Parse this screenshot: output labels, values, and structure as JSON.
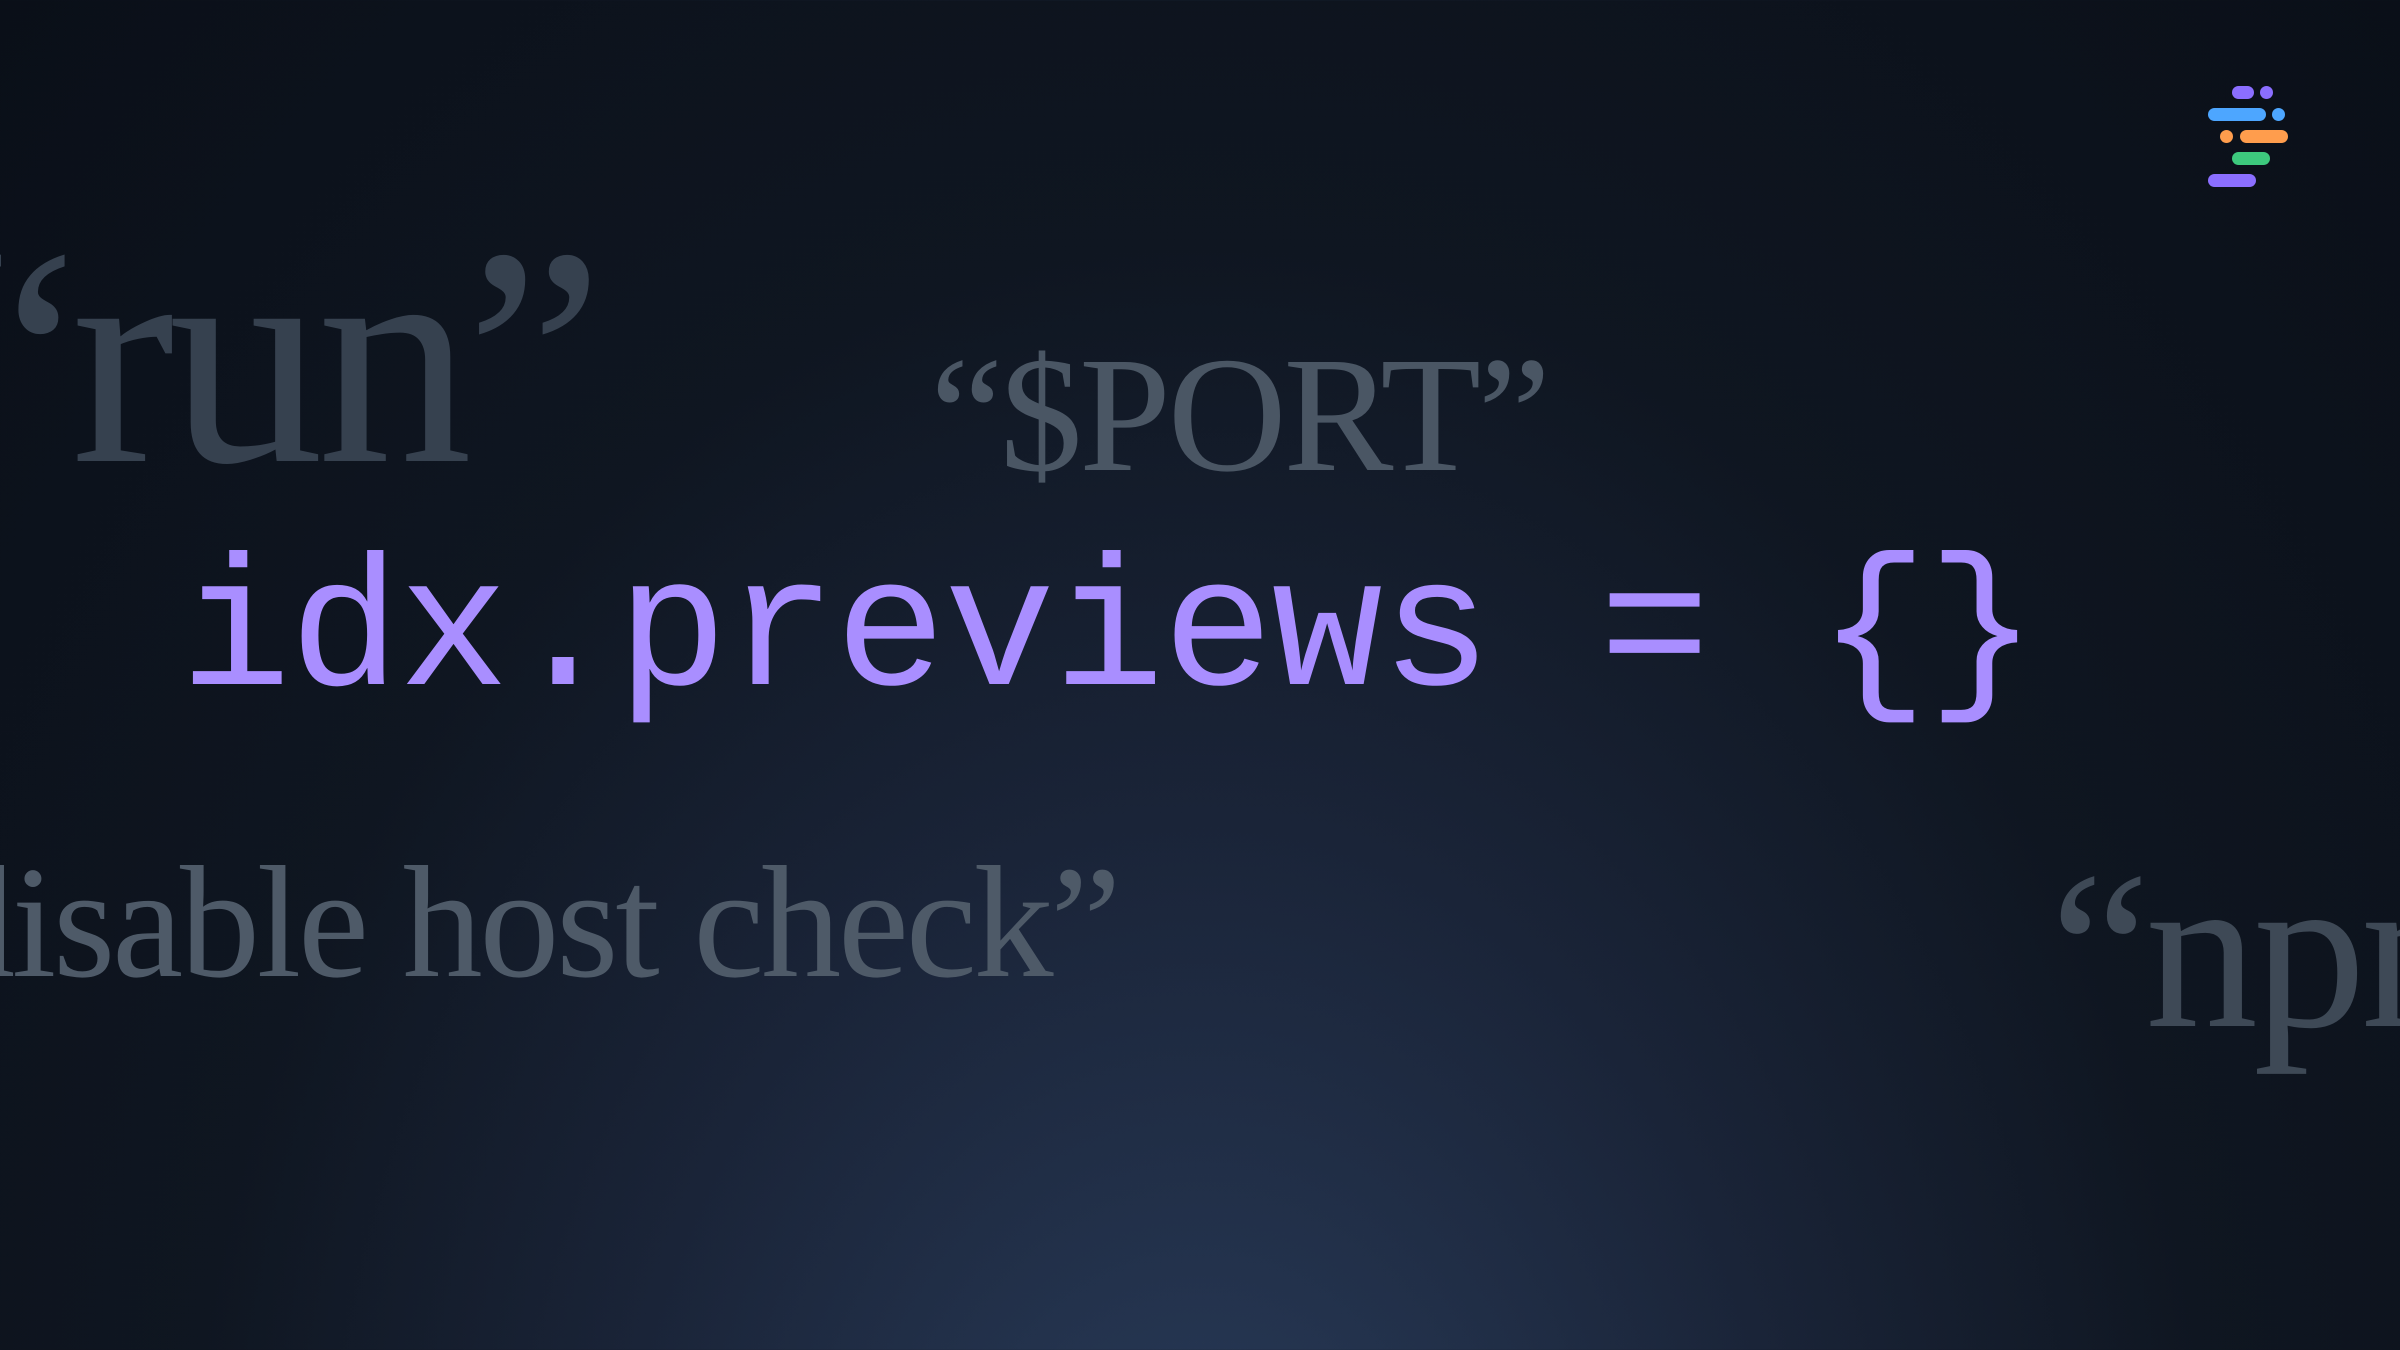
{
  "background_snippets": {
    "run": "“run”",
    "port": "“$PORT”",
    "disable_host_check": "disable host check”",
    "npm": "“npm"
  },
  "main_code": "idx.previews = {}",
  "logo": {
    "name": "idx-logo"
  },
  "colors": {
    "accent_purple": "#a98eff",
    "muted_text": "#4a5664",
    "bg_dark": "#0a0f18",
    "logo_purple": "#8b6eff",
    "logo_blue": "#4da6ff",
    "logo_orange": "#ff9d4d",
    "logo_green": "#3dc97d"
  }
}
